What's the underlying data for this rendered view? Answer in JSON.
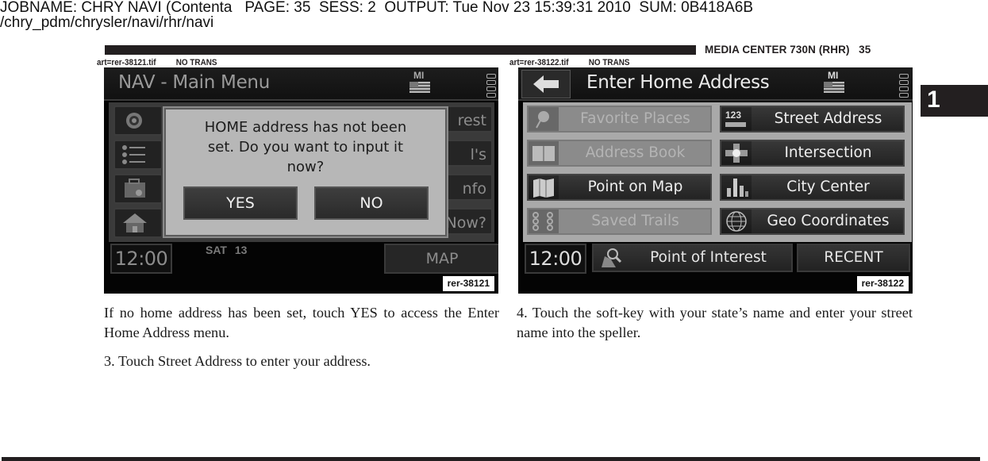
{
  "print_header": {
    "line1": "JOBNAME: CHRY NAVI (Contenta   PAGE: 35  SESS: 2  OUTPUT: Tue Nov 23 15:39:31 2010  SUM: 0B418A6B",
    "line2": "/chry_pdm/chrysler/navi/rhr/navi"
  },
  "running_head": "MEDIA CENTER 730N (RHR)   35",
  "chapter_tab": "1",
  "figures": [
    {
      "art_file": "art=rer-38121.tif",
      "trans": "NO TRANS",
      "tag": "rer-38121",
      "title": "NAV - Main Menu",
      "state": "MI",
      "left_icons": [
        "target-icon",
        "list-icon",
        "briefcase-icon",
        "home-icon"
      ],
      "right_buttons": [
        "rest",
        "l's",
        "nfo",
        "Now?"
      ],
      "dialog": {
        "message": "HOME address has not been set. Do you want to input it now?",
        "yes": "YES",
        "no": "NO"
      },
      "clock": "12:00",
      "day": "SAT",
      "date": "13",
      "map_button": "MAP"
    },
    {
      "art_file": "art=rer-38122.tif",
      "trans": "NO TRANS",
      "tag": "rer-38122",
      "title": "Enter Home Address",
      "state": "MI",
      "menu": [
        {
          "label": "Favorite Places",
          "icon": "pushpin-icon",
          "enabled": false
        },
        {
          "label": "Street Address",
          "icon": "number-123-icon",
          "enabled": true
        },
        {
          "label": "Address Book",
          "icon": "address-book-icon",
          "enabled": false
        },
        {
          "label": "Intersection",
          "icon": "intersection-icon",
          "enabled": true
        },
        {
          "label": "Point on Map",
          "icon": "folded-map-icon",
          "enabled": true
        },
        {
          "label": "City Center",
          "icon": "city-skyline-icon",
          "enabled": true
        },
        {
          "label": "Saved Trails",
          "icon": "trail-dots-icon",
          "enabled": false
        },
        {
          "label": "Geo Coordinates",
          "icon": "globe-grid-icon",
          "enabled": true
        }
      ],
      "clock": "12:00",
      "poi_button": "Point of Interest",
      "recent_button": "RECENT"
    }
  ],
  "text": {
    "p1": "If no home address has been set, touch YES to access the Enter Home Address menu.",
    "p2": "3.  Touch Street Address to enter your address.",
    "p3": "4.  Touch the soft-key with your state’s name and enter your street name into the speller."
  }
}
